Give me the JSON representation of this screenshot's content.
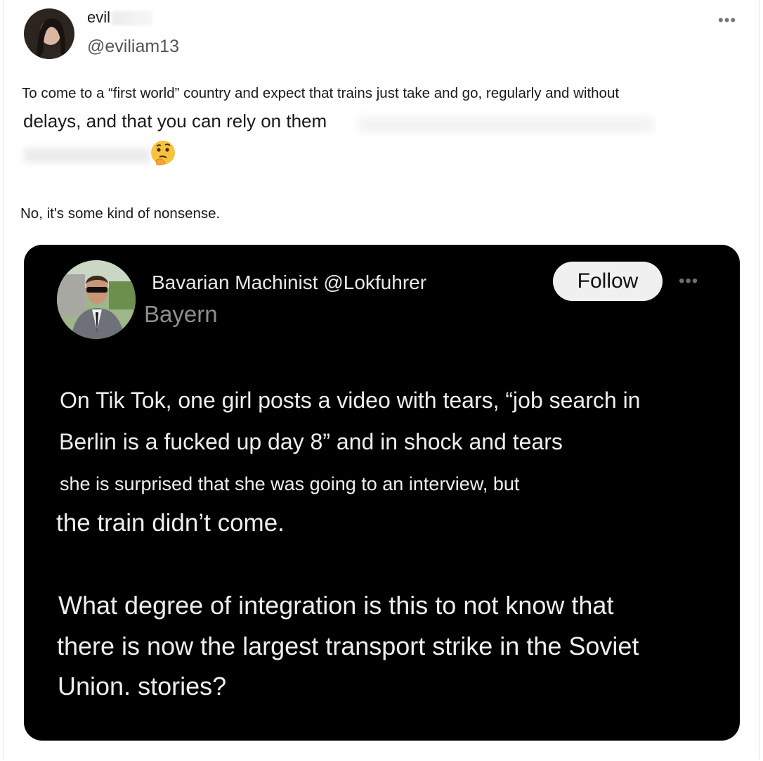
{
  "author": {
    "display_name": "evil",
    "handle": "@eviliam13",
    "more_label": "•••"
  },
  "post": {
    "line1": "To come to a “first world” country and expect that trains just take and go, regularly and without",
    "line2": "delays, and that you can rely on them",
    "emoji": "thinking-face-icon",
    "reply": "No, it's some kind of nonsense."
  },
  "quoted": {
    "name_handle": "Bavarian Machinist @Lokfuhrer",
    "location": "Bayern",
    "follow_label": "Follow",
    "more_label": "•••",
    "lines": [
      "On Tik Tok, one girl posts a video with tears, “job search in",
      "Berlin is a fucked up day 8” and in shock and tears",
      "she is surprised that she was going to an interview, but",
      "the train didn’t come.",
      "What degree of integration is this to not know that",
      "there is now the largest transport strike in the Soviet",
      "Union. stories?"
    ]
  },
  "colors": {
    "card_bg": "#000000",
    "follow_bg": "#f0f0f0",
    "location": "#8e8e8e"
  }
}
